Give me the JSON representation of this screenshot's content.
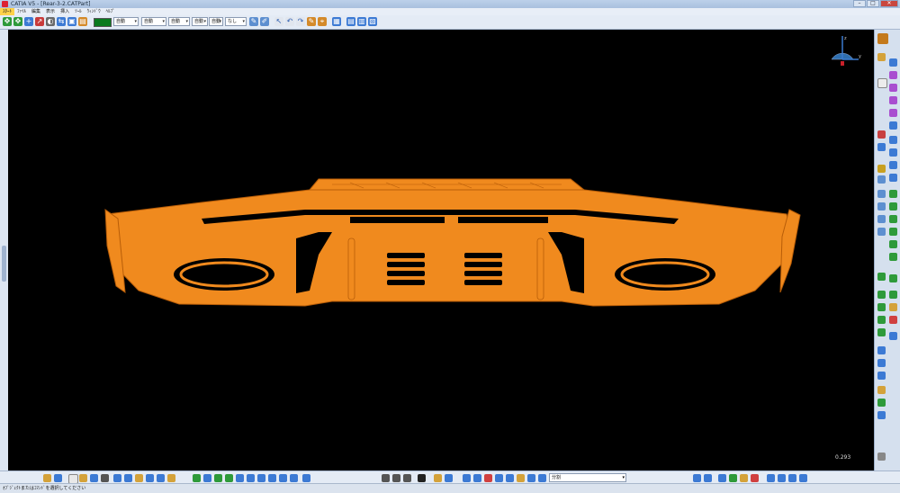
{
  "window": {
    "title": "CATIA V5 - [Rear-3-2.CATPart]",
    "buttons": {
      "minimize": "–",
      "maximize": "□",
      "close": "✕"
    }
  },
  "menu": {
    "items": [
      "ｽﾀｰﾄ",
      "ﾌｧｲﾙ",
      "編集",
      "表示",
      "挿入",
      "ﾂｰﾙ",
      "ｳｨﾝﾄﾞｳ",
      "ﾍﾙﾌﾟ"
    ]
  },
  "toolbar": {
    "color_swatch": "#0a7a1f",
    "dropdowns": [
      "自動",
      "自動",
      "自動",
      "自動",
      "自動",
      "なし"
    ]
  },
  "bottom": {
    "selector_value": "分割"
  },
  "viewport": {
    "zoom_value": "0.293",
    "part_color": "#f08a1e"
  },
  "compass": {
    "x": "x",
    "y": "y",
    "z": "z"
  },
  "status": {
    "message": "ｵﾌﾞｼﾞｪｸﾄまたはｺﾏﾝﾄﾞを選択してください"
  }
}
